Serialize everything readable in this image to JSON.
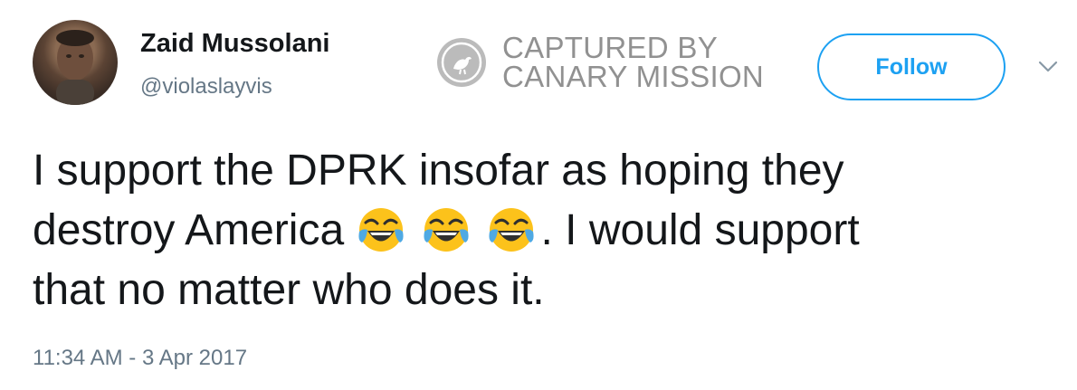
{
  "user": {
    "display_name": "Zaid Mussolani",
    "handle": "@violaslayvis"
  },
  "watermark": {
    "line1": "CAPTURED BY",
    "line2": "CANARY MISSION"
  },
  "actions": {
    "follow_label": "Follow",
    "menu_icon": "chevron-down-icon"
  },
  "tweet": {
    "line1": "I support the DPRK insofar as hoping they",
    "line2_before": "destroy America",
    "emojis": [
      "face-with-tears-of-joy",
      "face-with-tears-of-joy",
      "face-with-tears-of-joy"
    ],
    "line2_after": ". I would support",
    "line3": "that no matter who does it."
  },
  "meta": {
    "timestamp": "11:34 AM - 3 Apr 2017"
  },
  "colors": {
    "accent": "#1da1f2",
    "text": "#14171a",
    "muted": "#657786",
    "watermark": "#8c8c8c"
  }
}
